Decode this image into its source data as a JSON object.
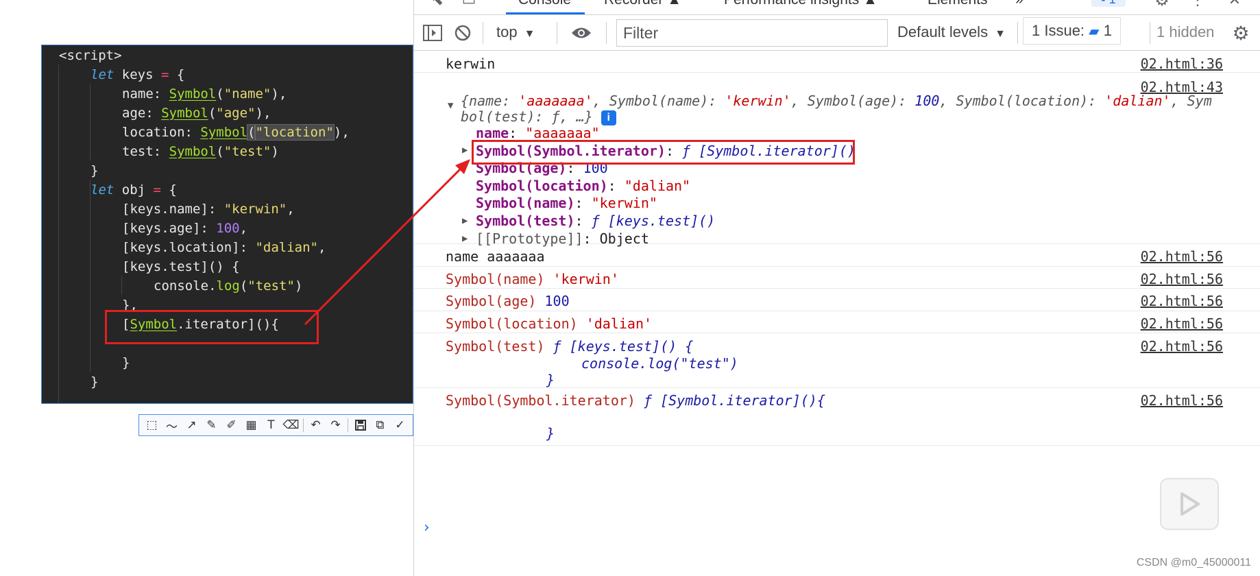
{
  "editor": {
    "lines": {
      "l1": "<script>",
      "l2a": "let",
      "l2b": " keys ",
      "l2c": "=",
      "l2d": " {",
      "l3a": "name: ",
      "l3b": "Symbol",
      "l3c": "(",
      "l3d": "\"name\"",
      "l3e": "),",
      "l4a": "age: ",
      "l4b": "Symbol",
      "l4c": "(",
      "l4d": "\"age\"",
      "l4e": "),",
      "l5a": "location: ",
      "l5b": "Symbol",
      "l5c": "(",
      "l5d": "\"location\"",
      "l5e": "),",
      "l6a": "test: ",
      "l6b": "Symbol",
      "l6c": "(",
      "l6d": "\"test\"",
      "l6e": ")",
      "l7": "}",
      "l8a": "let",
      "l8b": " obj ",
      "l8c": "=",
      "l8d": " {",
      "l9a": "[keys.name]: ",
      "l9b": "\"kerwin\"",
      "l9c": ",",
      "l10a": "[keys.age]: ",
      "l10b": "100",
      "l10c": ",",
      "l11a": "[keys.location]: ",
      "l11b": "\"dalian\"",
      "l11c": ",",
      "l12": "[keys.test]() {",
      "l13a": "console.",
      "l13b": "log",
      "l13c": "(",
      "l13d": "\"test\"",
      "l13e": ")",
      "l14": "},",
      "l15a": "[",
      "l15b": "Symbol",
      "l15c": ".iterator](){",
      "l17": "}",
      "l18": "}"
    }
  },
  "screenshot_toolbar": {
    "tools": [
      "shape-icon",
      "pencil-line-icon",
      "arrow-icon",
      "brush-icon",
      "marker-icon",
      "mosaic-icon",
      "text-icon",
      "eraser-icon",
      "undo-icon",
      "redo-icon",
      "save-icon",
      "copy-icon",
      "confirm-icon"
    ],
    "glyphs": [
      "⬚",
      "〜",
      "↗",
      "✎",
      "✐",
      "▦",
      "T",
      "⌫",
      "↶",
      "↷",
      "💾",
      "⧉",
      "✓"
    ]
  },
  "devtools": {
    "tabs": [
      "Console",
      "Recorder ▲",
      "Performance insights ▲",
      "Elements",
      "»"
    ],
    "toolbar": {
      "context": "top",
      "filter_placeholder": "Filter",
      "levels": "Default levels",
      "issues_label": "1 Issue:",
      "issues_count": "1",
      "hidden": "1 hidden"
    },
    "messages": {
      "m1_text": "kerwin",
      "m1_src": "02.html:36",
      "m2_src": "02.html:43",
      "m2_preview": {
        "p1": "{name: ",
        "p2": "'aaaaaaa'",
        "p3": ", Symbol(name): ",
        "p4": "'kerwin'",
        "p5": ", Symbol(age): ",
        "p6": "100",
        "p7": ", Symbol(location): ",
        "p8": "'dalian'",
        "p9": ", Sym",
        "p10": "bol(test): ",
        "p11": "ƒ",
        "p12": ", …}",
        "info": "i"
      },
      "props": {
        "r1k": "name",
        "r1v": "\"aaaaaaa\"",
        "r2k": "Symbol(Symbol.iterator)",
        "r2v": "ƒ [Symbol.iterator]()",
        "r3k": "Symbol(age)",
        "r3v": "100",
        "r4k": "Symbol(location)",
        "r4v": "\"dalian\"",
        "r5k": "Symbol(name)",
        "r5v": "\"kerwin\"",
        "r6k": "Symbol(test)",
        "r6v": "ƒ [keys.test]()",
        "r7k": "[[Prototype]]",
        "r7v": "Object"
      },
      "sep": ": ",
      "m3_text": "name aaaaaaa",
      "m3_src": "02.html:56",
      "m4_a": "Symbol(name) ",
      "m4_b": "'kerwin'",
      "m4_src": "02.html:56",
      "m5_a": "Symbol(age) ",
      "m5_b": "100",
      "m5_src": "02.html:56",
      "m6_a": "Symbol(location) ",
      "m6_b": "'dalian'",
      "m6_src": "02.html:56",
      "m7_a": "Symbol(test) ",
      "m7_b": "ƒ [keys.test]() {",
      "m7_c": "console.log(\"test\")",
      "m7_d": "}",
      "m7_src": "02.html:56",
      "m8_a": "Symbol(Symbol.iterator) ",
      "m8_b": "ƒ [Symbol.iterator](){",
      "m8_d": "}",
      "m8_src": "02.html:56"
    },
    "prompt": "›"
  },
  "watermark": "CSDN @m0_45000011",
  "colors": {
    "annotation_red": "#e02020",
    "devtools_blue": "#1a73e8"
  }
}
